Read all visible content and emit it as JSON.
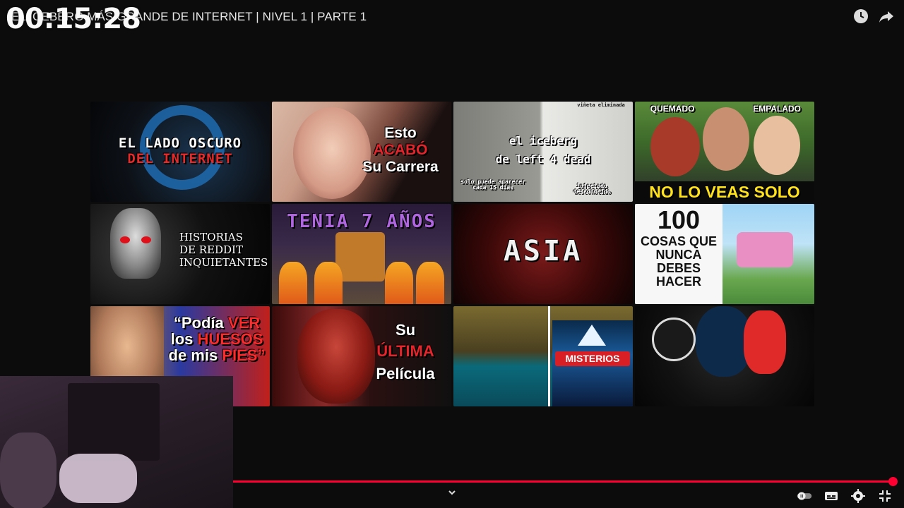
{
  "player": {
    "video_title": "EL ICEBERG MÁS GRANDE DE INTERNET | NIVEL 1 | PARTE 1",
    "timer": "00:15:28",
    "progress": 1.0,
    "accent_color": "#ff0033"
  },
  "top_icons": [
    "watch-later-icon",
    "share-icon"
  ],
  "thumbnails": [
    {
      "lines": [
        "EL LADO OSCURO",
        "DEL INTERNET"
      ]
    },
    {
      "lines": [
        "Esto",
        "ACABÓ",
        "Su Carrera"
      ]
    },
    {
      "lines": [
        "el iceberg",
        "de left 4 dead"
      ],
      "small": [
        "solo puede aparecer cada 15 días",
        "infectado desconocido",
        "viñeta eliminada"
      ]
    },
    {
      "labels": [
        "QUEMADO",
        "EMPALADO"
      ],
      "banner": "NO LO VEAS SOLO"
    },
    {
      "lines": [
        "HISTORIAS",
        "DE REDDIT",
        "INQUIETANTES"
      ]
    },
    {
      "lines": [
        "TENIA 7 AÑOS"
      ]
    },
    {
      "lines": [
        "ASIA"
      ]
    },
    {
      "lines": [
        "100",
        "COSAS QUE",
        "NUNCA",
        "DEBES",
        "HACER"
      ]
    },
    {
      "lines": [
        "“Podía",
        "VER",
        "los",
        "HUESOS",
        "de mis",
        "PIES”"
      ]
    },
    {
      "lines": [
        "Su",
        "ÚLTIMA",
        "Película"
      ]
    },
    {
      "badge": "MISTERIOS"
    },
    {
      "lines": []
    }
  ],
  "controls": [
    "chevron-down-icon",
    "autoplay-toggle-icon",
    "subtitles-icon",
    "settings-gear-icon",
    "exit-fullscreen-icon"
  ]
}
